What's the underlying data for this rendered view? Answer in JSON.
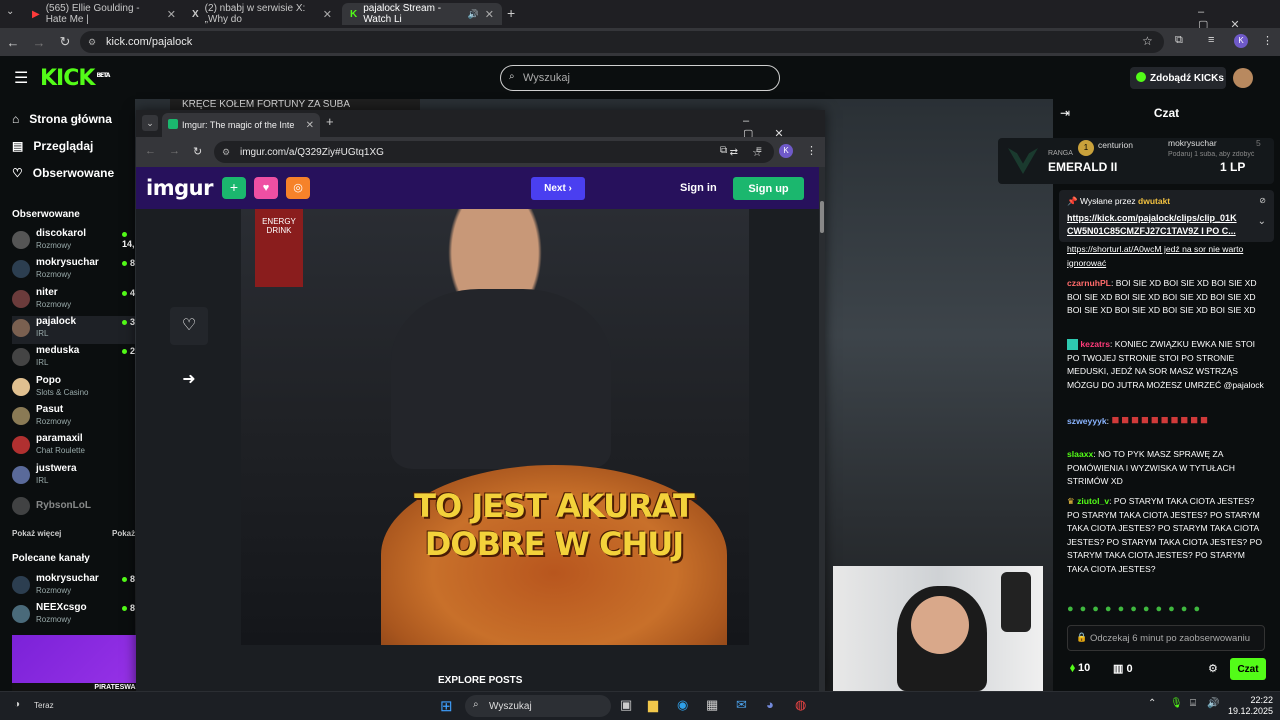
{
  "browser": {
    "tabs": [
      {
        "label": "(565) Ellie Goulding - Hate Me |"
      },
      {
        "label": "(2) nbabj w serwisie X: „Why do"
      },
      {
        "label": "pajalock Stream - Watch Li"
      }
    ],
    "url": "kick.com/pajalock"
  },
  "kick": {
    "logo": "KICK",
    "beta": "BETA",
    "search_placeholder": "Wyszukaj",
    "get_kicks": "Zdobądź KICKs",
    "nav": [
      "Strona główna",
      "Przeglądaj",
      "Obserwowane"
    ],
    "followed_header": "Obserwowane",
    "followed": [
      {
        "name": "discokarol",
        "cat": "Rozmowy",
        "viewers": "14,"
      },
      {
        "name": "mokrysuchar",
        "cat": "Rozmowy",
        "viewers": "8,"
      },
      {
        "name": "niter",
        "cat": "Rozmowy",
        "viewers": "4,"
      },
      {
        "name": "pajalock",
        "cat": "IRL",
        "viewers": "3,"
      },
      {
        "name": "meduska",
        "cat": "IRL",
        "viewers": "2,"
      },
      {
        "name": "Popo",
        "cat": "Slots & Casino",
        "viewers": ""
      },
      {
        "name": "Pasut",
        "cat": "Rozmowy",
        "viewers": ""
      },
      {
        "name": "paramaxil",
        "cat": "Chat Roulette",
        "viewers": ""
      },
      {
        "name": "justwera",
        "cat": "IRL",
        "viewers": ""
      },
      {
        "name": "RybsonLoL",
        "cat": "",
        "viewers": ""
      }
    ],
    "show_more": "Pokaż więcej",
    "show_more2": "Pokaż",
    "recommended_header": "Polecane kanały",
    "recommended": [
      {
        "name": "mokrysuchar",
        "cat": "Rozmowy",
        "viewers": "8,"
      },
      {
        "name": "NEEXcsgo",
        "cat": "Rozmowy",
        "viewers": "8,"
      }
    ],
    "stream_banner": "KRĘCE KOŁEM FORTUNY ZA SUBA",
    "ad_text": "PIRATESWAP.COM",
    "ad_sub": "Teraz"
  },
  "imgur_window": {
    "tab_title": "Imgur: The magic of the Interne",
    "url": "imgur.com/a/Q329Ziy#UGtq1XG",
    "logo": "imgur",
    "next": "Next",
    "sign_in": "Sign in",
    "sign_up": "Sign up",
    "meme_line1": "TO JEST AKURAT",
    "meme_line2": "DOBRE W CHUJ",
    "can_text": "ENERGY DRINK",
    "explore": "EXPLORE POSTS"
  },
  "chat": {
    "title": "Czat",
    "rank_label": "RANGA",
    "rank": "EMERALD II",
    "lp": "1 LP",
    "gifters": [
      {
        "name": "centurion",
        "count": "1"
      },
      {
        "name": "mokrysuchar",
        "count": "5"
      }
    ],
    "gifter_note": "Podaruj 1 suba, aby zdobyć",
    "pinned_by_label": "Wysłane przez",
    "pinned_by": "dwutakt",
    "pinned_link": "https://kick.com/pajalock/clips/clip_01K CW5N01C85CMZFJ27C1TAV9Z I PO C...",
    "messages": [
      {
        "user": "",
        "text": "https://shorturl.at/A0wcM jedź na sor nie warto ignorować",
        "color": "#ffffff"
      },
      {
        "user": "czarnuhPL",
        "text": "BOI SIE XD BOI SIE XD BOI SIE XD BOI SIE XD BOI SIE XD BOI SIE XD BOI SIE XD BOI SIE XD BOI SIE XD BOI SIE XD BOI SIE XD",
        "color": "#ff6b6b"
      },
      {
        "user": "kezatrs",
        "text": "KONIEC ZWIĄZKU EWKA NIE STOI PO TWOJEJ STRONIE STOI PO STRONIE MEDUSKI, JEDŹ NA SOR MASZ WSTRZĄS MÓZGU DO JUTRA MOŻESZ UMRZEĆ @pajalock",
        "color": "#ff3b7a"
      },
      {
        "user": "szweyyyk",
        "text": "",
        "color": "#8ab4ff"
      },
      {
        "user": "slaaxx",
        "text": "NO TO PYK MASZ SPRAWĘ ZA POMÓWIENIA I WYZWISKA W TYTUŁACH STRIMÓW XD",
        "color": "#53fc18"
      },
      {
        "user": "ziutol_v",
        "text": "PO STARYM TAKA CIOTA JESTES? PO STARYM TAKA CIOTA JESTES? PO STARYM TAKA CIOTA JESTES? PO STARYM TAKA CIOTA JESTES? PO STARYM TAKA CIOTA JESTES? PO STARYM TAKA CIOTA JESTES? PO STARYM TAKA CIOTA JESTES?",
        "color": "#53fc18"
      }
    ],
    "input_placeholder": "Odczekaj 6 minut po zaobserwowaniu",
    "points": "10",
    "count2": "0",
    "send": "Czat"
  },
  "taskbar": {
    "search": "Wyszukaj",
    "time": "22:22",
    "date": "19.12.2025"
  }
}
